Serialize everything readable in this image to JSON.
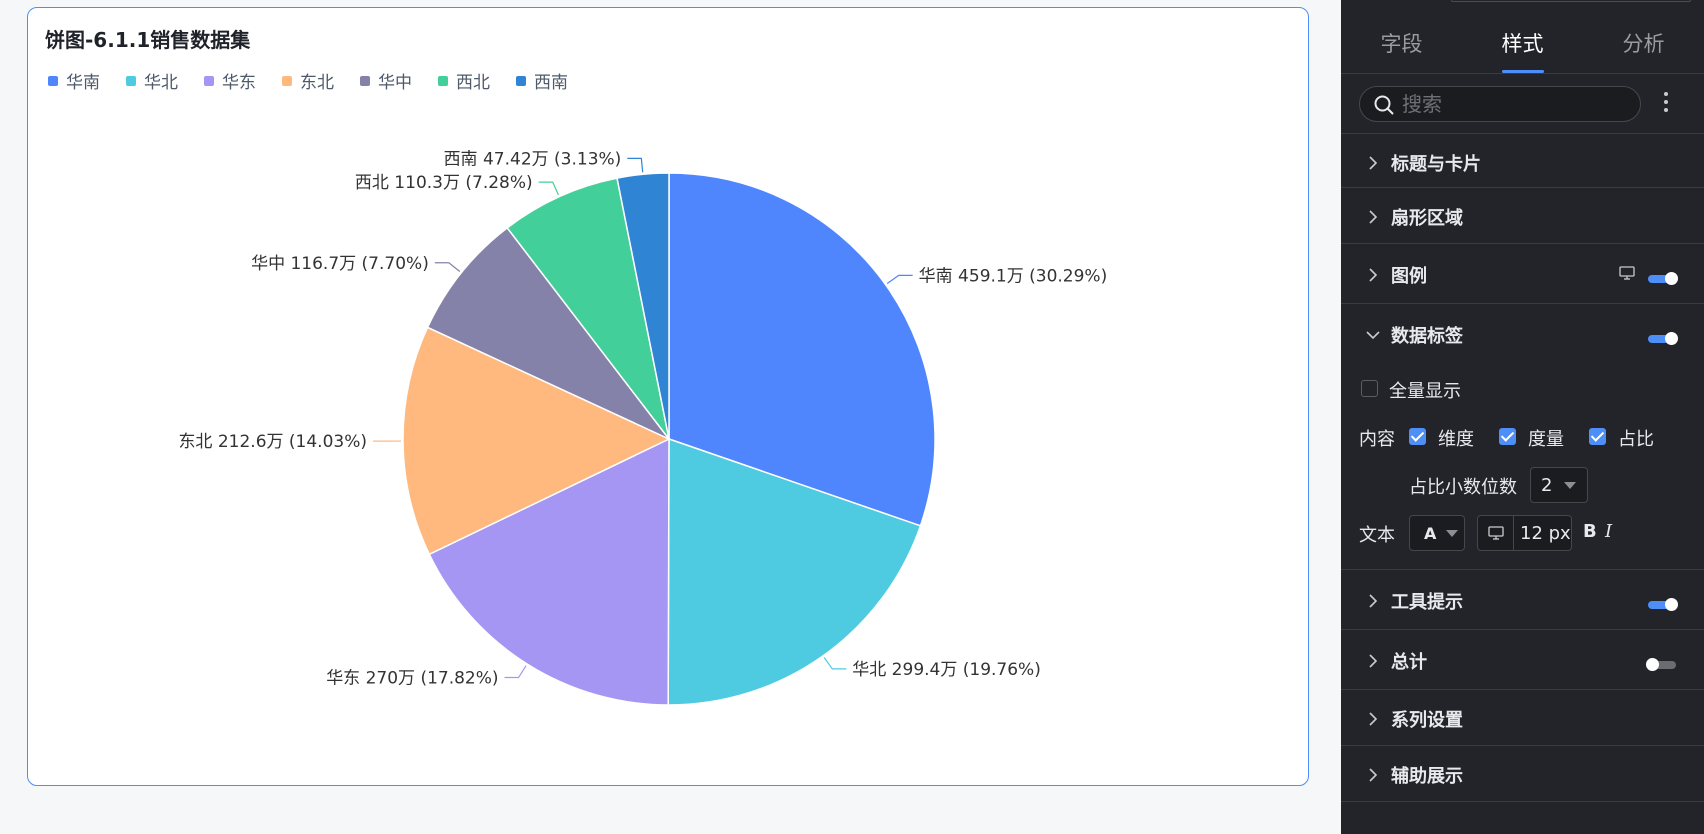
{
  "chart": {
    "title": "饼图-6.1.1销售数据集",
    "legend": [
      {
        "label": "华南",
        "color": "#4f86fd"
      },
      {
        "label": "华北",
        "color": "#4ecbe0"
      },
      {
        "label": "华东",
        "color": "#a596f3"
      },
      {
        "label": "东北",
        "color": "#ffb97f"
      },
      {
        "label": "华中",
        "color": "#8482a8"
      },
      {
        "label": "西北",
        "color": "#43cf9a"
      },
      {
        "label": "西南",
        "color": "#2f84d4"
      }
    ]
  },
  "chart_data": {
    "type": "pie",
    "title": "饼图-6.1.1销售数据集",
    "legend_position": "top-left",
    "categories": [
      "华南",
      "华北",
      "华东",
      "东北",
      "华中",
      "西北",
      "西南"
    ],
    "values": [
      459.1,
      299.4,
      270,
      212.6,
      116.7,
      110.3,
      47.42
    ],
    "percentages": [
      30.29,
      19.76,
      17.82,
      14.03,
      7.7,
      7.28,
      3.13
    ],
    "unit": "万",
    "labels": [
      "华南 459.1万 (30.29%)",
      "华北 299.4万 (19.76%)",
      "华东 270万 (17.82%)",
      "东北 212.6万 (14.03%)",
      "华中 116.7万 (7.70%)",
      "西北 110.3万 (7.28%)",
      "西南 47.42万 (3.13%)"
    ],
    "colors": [
      "#4f86fd",
      "#4ecbe0",
      "#a596f3",
      "#ffb97f",
      "#8482a8",
      "#43cf9a",
      "#2f84d4"
    ]
  },
  "panel": {
    "tabs": [
      "字段",
      "样式",
      "分析"
    ],
    "active_tab": "样式",
    "search_placeholder": "搜索",
    "sections": {
      "title_card": "标题与卡片",
      "sector": "扇形区域",
      "legend": "图例",
      "data_label": "数据标签",
      "tooltip": "工具提示",
      "total": "总计",
      "series": "系列设置",
      "aux": "辅助展示"
    },
    "toggles": {
      "legend": true,
      "data_label": true,
      "tooltip": true,
      "total": false
    },
    "data_label": {
      "show_all": "全量显示",
      "content_label": "内容",
      "dimension": "维度",
      "measure": "度量",
      "ratio": "占比",
      "decimals_label": "占比小数位数",
      "decimals_value": "2",
      "text_label": "文本",
      "font_letter": "A",
      "font_size": "12 px",
      "bold": "B",
      "italic": "I"
    }
  }
}
